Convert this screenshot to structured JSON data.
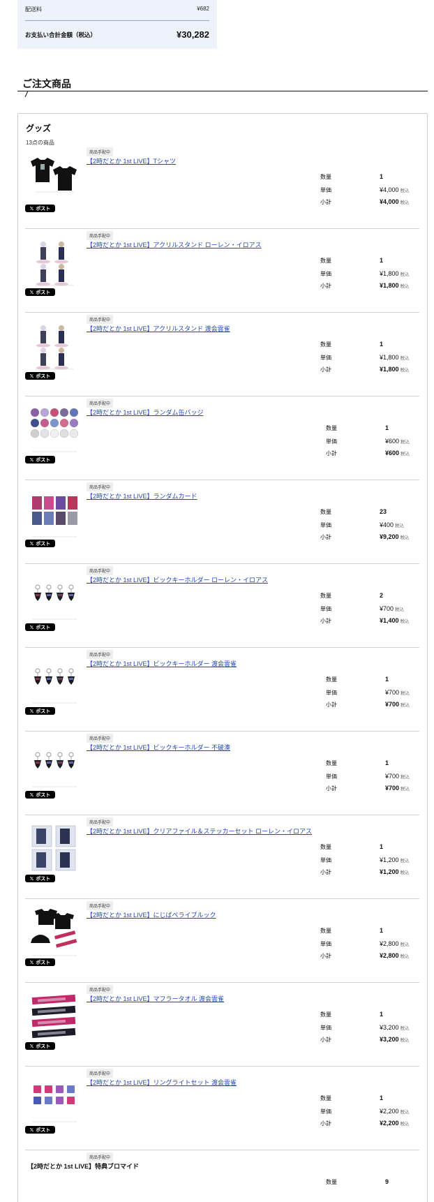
{
  "summary": {
    "shipping_label": "配送料",
    "shipping_value": "¥682",
    "total_label": "お支払い合計金額（税込）",
    "total_value": "¥30,282"
  },
  "section_title": "ご注文商品",
  "card": {
    "title": "グッズ",
    "count": "13点の商品"
  },
  "labels": {
    "quantity": "数量",
    "unit_price": "単価",
    "subtotal": "小計",
    "tax": "税込",
    "post": "ポスト",
    "badge": "商品手配中"
  },
  "items": [
    {
      "name": "【2時だとか 1st LIVE】Tシャツ",
      "qty": "1",
      "price": "¥4,000",
      "subtotal": "¥4,000",
      "thumb": "tshirt-image"
    },
    {
      "name": "【2時だとか 1st LIVE】アクリルスタンド ローレン・イロアス",
      "qty": "1",
      "price": "¥1,800",
      "subtotal": "¥1,800",
      "thumb": "acrylic-stand-image"
    },
    {
      "name": "【2時だとか 1st LIVE】アクリルスタンド 渡会雲雀",
      "qty": "1",
      "price": "¥1,800",
      "subtotal": "¥1,800",
      "thumb": "acrylic-stand-image"
    },
    {
      "name": "【2時だとか 1st LIVE】ランダム缶バッジ",
      "qty": "1",
      "price": "¥600",
      "subtotal": "¥600",
      "thumb": "badge-image"
    },
    {
      "name": "【2時だとか 1st LIVE】ランダムカード",
      "qty": "23",
      "price": "¥400",
      "subtotal": "¥9,200",
      "thumb": "card-image"
    },
    {
      "name": "【2時だとか 1st LIVE】ビックキーホルダー ローレン・イロアス",
      "qty": "2",
      "price": "¥700",
      "subtotal": "¥1,400",
      "thumb": "keychain-image"
    },
    {
      "name": "【2時だとか 1st LIVE】ビックキーホルダー 渡会雲雀",
      "qty": "1",
      "price": "¥700",
      "subtotal": "¥700",
      "thumb": "keychain-image"
    },
    {
      "name": "【2時だとか 1st LIVE】ビックキーホルダー 不破湊",
      "qty": "1",
      "price": "¥700",
      "subtotal": "¥700",
      "thumb": "keychain-image"
    },
    {
      "name": "【2時だとか 1st LIVE】クリアファイル＆ステッカーセット ローレン・イロアス",
      "qty": "1",
      "price": "¥1,200",
      "subtotal": "¥1,200",
      "thumb": "clearfile-image"
    },
    {
      "name": "【2時だとか 1st LIVE】にじばぺライブルック",
      "qty": "1",
      "price": "¥2,800",
      "subtotal": "¥2,800",
      "thumb": "livelook-image"
    },
    {
      "name": "【2時だとか 1st LIVE】マフラータオル 渡会雲雀",
      "qty": "1",
      "price": "¥3,200",
      "subtotal": "¥3,200",
      "thumb": "towel-image"
    },
    {
      "name": "【2時だとか 1st LIVE】リングライトセット 渡会雲雀",
      "qty": "1",
      "price": "¥2,200",
      "subtotal": "¥2,200",
      "thumb": "ringlight-image"
    },
    {
      "name": "【2時だとか 1st LIVE】特典ブロマイド",
      "qty": "9",
      "price": "",
      "subtotal": "",
      "thumb": ""
    }
  ]
}
